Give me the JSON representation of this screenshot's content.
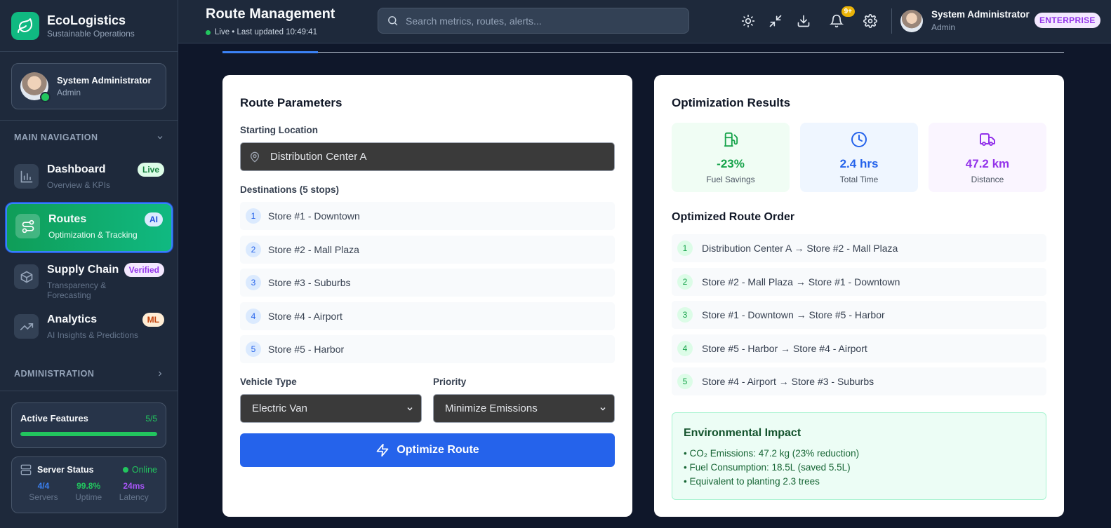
{
  "brand": {
    "title": "EcoLogistics",
    "subtitle": "Sustainable Operations",
    "logo_icon": "leaf-icon",
    "color": "#10b981"
  },
  "user": {
    "name": "System Administrator",
    "role": "Admin",
    "online": true
  },
  "sidebar": {
    "main_label": "MAIN NAVIGATION",
    "admin_label": "ADMINISTRATION",
    "items": [
      {
        "title": "Dashboard",
        "subtitle": "Overview & KPIs",
        "badge": "Live",
        "icon": "bar-chart-icon",
        "badge_bg": "#dcfce7",
        "badge_fg": "#15803d",
        "active": false
      },
      {
        "title": "Routes",
        "subtitle": "Optimization & Tracking",
        "badge": "AI",
        "icon": "route-icon",
        "badge_bg": "#dbeafe",
        "badge_fg": "#1d4ed8",
        "active": true
      },
      {
        "title": "Supply Chain",
        "subtitle": "Transparency & Forecasting",
        "badge": "Verified",
        "icon": "package-icon",
        "badge_bg": "#f3e8ff",
        "badge_fg": "#9333ea",
        "active": false
      },
      {
        "title": "Analytics",
        "subtitle": "AI Insights & Predictions",
        "badge": "ML",
        "icon": "trending-up-icon",
        "badge_bg": "#ffedd5",
        "badge_fg": "#c2410c",
        "active": false
      }
    ],
    "features": {
      "title": "Active Features",
      "count": "5/5",
      "progress": 1.0
    },
    "server": {
      "title": "Server Status",
      "status": "Online",
      "stats": [
        {
          "value": "4/4",
          "label": "Servers",
          "color": "#3b82f6"
        },
        {
          "value": "99.8%",
          "label": "Uptime",
          "color": "#22c55e"
        },
        {
          "value": "24ms",
          "label": "Latency",
          "color": "#a855f7"
        }
      ]
    }
  },
  "header": {
    "title": "Route Management",
    "live_text": "Live • Last updated 10:49:41",
    "search_placeholder": "Search metrics, routes, alerts...",
    "notifications": "9+",
    "plan": "ENTERPRISE"
  },
  "left": {
    "title": "Route Parameters",
    "start_label": "Starting Location",
    "start_value": "Distribution Center A",
    "dest_label": "Destinations (5 stops)",
    "destinations": [
      {
        "n": "1",
        "name": "Store #1 - Downtown"
      },
      {
        "n": "2",
        "name": "Store #2 - Mall Plaza"
      },
      {
        "n": "3",
        "name": "Store #3 - Suburbs"
      },
      {
        "n": "4",
        "name": "Store #4 - Airport"
      },
      {
        "n": "5",
        "name": "Store #5 - Harbor"
      }
    ],
    "vehicle_label": "Vehicle Type",
    "vehicle_value": "Electric Van",
    "priority_label": "Priority",
    "priority_value": "Minimize Emissions",
    "button": "Optimize Route"
  },
  "right": {
    "title": "Optimization Results",
    "metrics": [
      {
        "value": "-23%",
        "label": "Fuel Savings",
        "icon": "fuel-icon",
        "bg": "#f0fdf4",
        "color": "#16a34a"
      },
      {
        "value": "2.4 hrs",
        "label": "Total Time",
        "icon": "clock-icon",
        "bg": "#eff6ff",
        "color": "#2563eb"
      },
      {
        "value": "47.2 km",
        "label": "Distance",
        "icon": "truck-icon",
        "bg": "#faf5ff",
        "color": "#9333ea"
      }
    ],
    "order_title": "Optimized Route Order",
    "order": [
      {
        "n": "1",
        "text": "Distribution Center A → Store #2 - Mall Plaza"
      },
      {
        "n": "2",
        "text": "Store #2 - Mall Plaza → Store #1 - Downtown"
      },
      {
        "n": "3",
        "text": "Store #1 - Downtown → Store #5 - Harbor"
      },
      {
        "n": "4",
        "text": "Store #5 - Harbor → Store #4 - Airport"
      },
      {
        "n": "5",
        "text": "Store #4 - Airport → Store #3 - Suburbs"
      }
    ],
    "impact": {
      "title": "Environmental Impact",
      "lines": [
        "• CO₂ Emissions: 47.2 kg (23% reduction)",
        "• Fuel Consumption: 18.5L (saved 5.5L)",
        "• Equivalent to planting 2.3 trees"
      ]
    }
  }
}
